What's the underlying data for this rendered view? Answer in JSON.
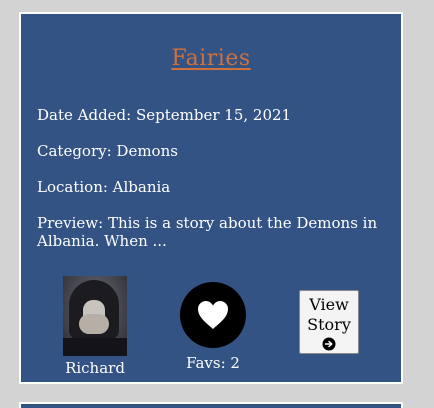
{
  "story": {
    "title": "Fairies",
    "date_added": "Date Added: September 15, 2021",
    "category": "Category: Demons",
    "location": "Location: Albania",
    "preview": "Preview: This is a story about the Demons in Albania. When ...",
    "author": {
      "name": "Richard",
      "avatar_icon": "hooded-person-avatar"
    },
    "favs_label": "Favs: 2",
    "favs_count": 2,
    "view_button": {
      "label": "View Story",
      "icon": "arrow-right-circle-icon"
    }
  },
  "colors": {
    "page_background": "#d3d3d3",
    "card_background": "#345385",
    "title_color": "#d0703a",
    "text_color": "#ffffff",
    "fav_button": "#000000"
  }
}
